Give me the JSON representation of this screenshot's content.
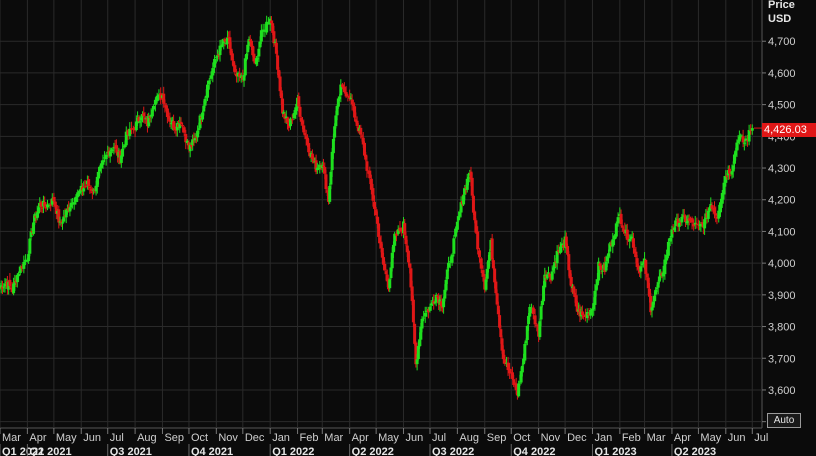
{
  "header": {
    "price_label": "Price",
    "currency": "USD"
  },
  "controls": {
    "auto_label": "Auto"
  },
  "colors": {
    "background": "#0b0b0b",
    "grid": "#2a2a2a",
    "up": "#1ee01e",
    "down": "#e01717",
    "text": "#cfcfcf",
    "last_price_bg": "#e01717"
  },
  "chart_data": {
    "type": "candlestick",
    "title": "",
    "ylabel": "Price USD",
    "ylim": [
      3480,
      4830
    ],
    "yticks": [
      3500,
      3600,
      3700,
      3800,
      3900,
      4000,
      4100,
      4200,
      4300,
      4400,
      4500,
      4600,
      4700
    ],
    "ytick_labels": [
      "3,500",
      "3,600",
      "3,700",
      "3,800",
      "3,900",
      "4,000",
      "4,100",
      "4,200",
      "4,300",
      "4,400",
      "4,500",
      "4,600",
      "4,700"
    ],
    "last_price": 4426.03,
    "last_price_label": "4,426.03",
    "x_start": "2021-03-01",
    "x_end": "2023-07-12",
    "months": [
      {
        "label": "Mar",
        "date": "2021-03-01"
      },
      {
        "label": "Apr",
        "date": "2021-04-01"
      },
      {
        "label": "May",
        "date": "2021-05-01"
      },
      {
        "label": "Jun",
        "date": "2021-06-01"
      },
      {
        "label": "Jul",
        "date": "2021-07-01"
      },
      {
        "label": "Aug",
        "date": "2021-08-01"
      },
      {
        "label": "Sep",
        "date": "2021-09-01"
      },
      {
        "label": "Oct",
        "date": "2021-10-01"
      },
      {
        "label": "Nov",
        "date": "2021-11-01"
      },
      {
        "label": "Dec",
        "date": "2021-12-01"
      },
      {
        "label": "Jan",
        "date": "2022-01-01"
      },
      {
        "label": "Feb",
        "date": "2022-02-01"
      },
      {
        "label": "Mar",
        "date": "2022-03-01"
      },
      {
        "label": "Apr",
        "date": "2022-04-01"
      },
      {
        "label": "May",
        "date": "2022-05-01"
      },
      {
        "label": "Jun",
        "date": "2022-06-01"
      },
      {
        "label": "Jul",
        "date": "2022-07-01"
      },
      {
        "label": "Aug",
        "date": "2022-08-01"
      },
      {
        "label": "Sep",
        "date": "2022-09-01"
      },
      {
        "label": "Oct",
        "date": "2022-10-01"
      },
      {
        "label": "Nov",
        "date": "2022-11-01"
      },
      {
        "label": "Dec",
        "date": "2022-12-01"
      },
      {
        "label": "Jan",
        "date": "2023-01-01"
      },
      {
        "label": "Feb",
        "date": "2023-02-01"
      },
      {
        "label": "Mar",
        "date": "2023-03-01"
      },
      {
        "label": "Apr",
        "date": "2023-04-01"
      },
      {
        "label": "May",
        "date": "2023-05-01"
      },
      {
        "label": "Jun",
        "date": "2023-06-01"
      },
      {
        "label": "Jul",
        "date": "2023-07-01"
      }
    ],
    "quarters": [
      {
        "label": "Q1 2021",
        "date": "2021-03-01"
      },
      {
        "label": "Q2 2021",
        "date": "2021-04-01"
      },
      {
        "label": "Q3 2021",
        "date": "2021-07-01"
      },
      {
        "label": "Q4 2021",
        "date": "2021-10-01"
      },
      {
        "label": "Q1 2022",
        "date": "2022-01-01"
      },
      {
        "label": "Q2 2022",
        "date": "2022-04-01"
      },
      {
        "label": "Q3 2022",
        "date": "2022-07-01"
      },
      {
        "label": "Q4 2022",
        "date": "2022-10-01"
      },
      {
        "label": "Q1 2023",
        "date": "2023-01-01"
      },
      {
        "label": "Q2 2023",
        "date": "2023-04-01"
      }
    ],
    "series": [
      {
        "values": [
          [
            "2021-03-01",
            3925
          ],
          [
            "2021-03-08",
            3940
          ],
          [
            "2021-03-15",
            3915
          ],
          [
            "2021-03-22",
            3975
          ],
          [
            "2021-04-01",
            4020
          ],
          [
            "2021-04-08",
            4130
          ],
          [
            "2021-04-15",
            4185
          ],
          [
            "2021-04-22",
            4180
          ],
          [
            "2021-05-01",
            4200
          ],
          [
            "2021-05-08",
            4120
          ],
          [
            "2021-05-15",
            4160
          ],
          [
            "2021-05-22",
            4200
          ],
          [
            "2021-06-01",
            4230
          ],
          [
            "2021-06-08",
            4250
          ],
          [
            "2021-06-15",
            4225
          ],
          [
            "2021-06-22",
            4290
          ],
          [
            "2021-07-01",
            4350
          ],
          [
            "2021-07-08",
            4370
          ],
          [
            "2021-07-15",
            4330
          ],
          [
            "2021-07-22",
            4400
          ],
          [
            "2021-08-01",
            4430
          ],
          [
            "2021-08-08",
            4470
          ],
          [
            "2021-08-15",
            4440
          ],
          [
            "2021-08-22",
            4510
          ],
          [
            "2021-09-01",
            4530
          ],
          [
            "2021-09-08",
            4460
          ],
          [
            "2021-09-15",
            4430
          ],
          [
            "2021-09-22",
            4450
          ],
          [
            "2021-10-01",
            4360
          ],
          [
            "2021-10-08",
            4390
          ],
          [
            "2021-10-15",
            4470
          ],
          [
            "2021-10-22",
            4560
          ],
          [
            "2021-11-01",
            4650
          ],
          [
            "2021-11-08",
            4690
          ],
          [
            "2021-11-15",
            4700
          ],
          [
            "2021-11-22",
            4590
          ],
          [
            "2021-12-01",
            4580
          ],
          [
            "2021-12-08",
            4710
          ],
          [
            "2021-12-15",
            4620
          ],
          [
            "2021-12-22",
            4720
          ],
          [
            "2022-01-01",
            4780
          ],
          [
            "2022-01-08",
            4660
          ],
          [
            "2022-01-15",
            4480
          ],
          [
            "2022-01-22",
            4430
          ],
          [
            "2022-02-01",
            4510
          ],
          [
            "2022-02-08",
            4420
          ],
          [
            "2022-02-15",
            4350
          ],
          [
            "2022-02-22",
            4300
          ],
          [
            "2022-03-01",
            4320
          ],
          [
            "2022-03-08",
            4200
          ],
          [
            "2022-03-15",
            4440
          ],
          [
            "2022-03-22",
            4550
          ],
          [
            "2022-04-01",
            4530
          ],
          [
            "2022-04-08",
            4450
          ],
          [
            "2022-04-15",
            4390
          ],
          [
            "2022-04-22",
            4280
          ],
          [
            "2022-05-01",
            4150
          ],
          [
            "2022-05-08",
            4010
          ],
          [
            "2022-05-15",
            3930
          ],
          [
            "2022-05-22",
            4080
          ],
          [
            "2022-06-01",
            4120
          ],
          [
            "2022-06-08",
            3990
          ],
          [
            "2022-06-15",
            3680
          ],
          [
            "2022-06-22",
            3830
          ],
          [
            "2022-07-01",
            3860
          ],
          [
            "2022-07-08",
            3900
          ],
          [
            "2022-07-15",
            3870
          ],
          [
            "2022-07-22",
            3990
          ],
          [
            "2022-08-01",
            4120
          ],
          [
            "2022-08-08",
            4220
          ],
          [
            "2022-08-15",
            4290
          ],
          [
            "2022-08-22",
            4090
          ],
          [
            "2022-09-01",
            3930
          ],
          [
            "2022-09-08",
            4060
          ],
          [
            "2022-09-15",
            3880
          ],
          [
            "2022-09-22",
            3700
          ],
          [
            "2022-10-01",
            3640
          ],
          [
            "2022-10-08",
            3590
          ],
          [
            "2022-10-15",
            3700
          ],
          [
            "2022-10-22",
            3870
          ],
          [
            "2022-11-01",
            3780
          ],
          [
            "2022-11-08",
            3970
          ],
          [
            "2022-11-15",
            3960
          ],
          [
            "2022-11-22",
            4030
          ],
          [
            "2022-12-01",
            4070
          ],
          [
            "2022-12-08",
            3930
          ],
          [
            "2022-12-15",
            3850
          ],
          [
            "2022-12-22",
            3830
          ],
          [
            "2023-01-01",
            3860
          ],
          [
            "2023-01-08",
            3990
          ],
          [
            "2023-01-15",
            3980
          ],
          [
            "2023-01-22",
            4070
          ],
          [
            "2023-02-01",
            4150
          ],
          [
            "2023-02-08",
            4090
          ],
          [
            "2023-02-15",
            4080
          ],
          [
            "2023-02-22",
            3980
          ],
          [
            "2023-03-01",
            4000
          ],
          [
            "2023-03-08",
            3860
          ],
          [
            "2023-03-15",
            3920
          ],
          [
            "2023-03-22",
            3980
          ],
          [
            "2023-04-01",
            4110
          ],
          [
            "2023-04-08",
            4130
          ],
          [
            "2023-04-15",
            4140
          ],
          [
            "2023-04-22",
            4130
          ],
          [
            "2023-05-01",
            4110
          ],
          [
            "2023-05-08",
            4130
          ],
          [
            "2023-05-15",
            4190
          ],
          [
            "2023-05-22",
            4150
          ],
          [
            "2023-06-01",
            4280
          ],
          [
            "2023-06-08",
            4300
          ],
          [
            "2023-06-15",
            4400
          ],
          [
            "2023-06-22",
            4380
          ],
          [
            "2023-07-01",
            4426
          ]
        ]
      }
    ]
  }
}
